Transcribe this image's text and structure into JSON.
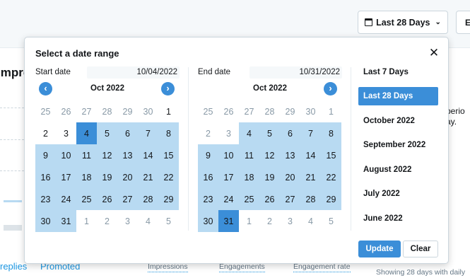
{
  "header": {
    "range_button_label": "Last 28 Days",
    "range_button_icon": "calendar-icon",
    "range_button_chevron": "chevron-down-icon",
    "export_button_label": "E"
  },
  "background": {
    "section_title": "Impres",
    "side_note": [
      "perio",
      "ay."
    ],
    "links": [
      "replies",
      "Promoted"
    ],
    "metric_tabs": [
      "Impressions",
      "Engagements",
      "Engagement rate"
    ],
    "showing_text": "Showing 28 days with daily"
  },
  "date_picker": {
    "title": "Select a date range",
    "close_icon": "close-icon",
    "start": {
      "label": "Start date",
      "value": "10/04/2022",
      "month": "Oct 2022",
      "prev_icon": "chevron-left-icon",
      "next_icon": "chevron-right-icon",
      "weeks": [
        [
          {
            "d": "25",
            "s": "other"
          },
          {
            "d": "26",
            "s": "other"
          },
          {
            "d": "27",
            "s": "other"
          },
          {
            "d": "28",
            "s": "other"
          },
          {
            "d": "29",
            "s": "other"
          },
          {
            "d": "30",
            "s": "other"
          },
          {
            "d": "1",
            "s": "plain"
          }
        ],
        [
          {
            "d": "2",
            "s": "plain"
          },
          {
            "d": "3",
            "s": "plain"
          },
          {
            "d": "4",
            "s": "sel"
          },
          {
            "d": "5",
            "s": "range"
          },
          {
            "d": "6",
            "s": "range"
          },
          {
            "d": "7",
            "s": "range"
          },
          {
            "d": "8",
            "s": "range"
          }
        ],
        [
          {
            "d": "9",
            "s": "range"
          },
          {
            "d": "10",
            "s": "range"
          },
          {
            "d": "11",
            "s": "range"
          },
          {
            "d": "12",
            "s": "range"
          },
          {
            "d": "13",
            "s": "range"
          },
          {
            "d": "14",
            "s": "range"
          },
          {
            "d": "15",
            "s": "range"
          }
        ],
        [
          {
            "d": "16",
            "s": "range"
          },
          {
            "d": "17",
            "s": "range"
          },
          {
            "d": "18",
            "s": "range"
          },
          {
            "d": "19",
            "s": "range"
          },
          {
            "d": "20",
            "s": "range"
          },
          {
            "d": "21",
            "s": "range"
          },
          {
            "d": "22",
            "s": "range"
          }
        ],
        [
          {
            "d": "23",
            "s": "range"
          },
          {
            "d": "24",
            "s": "range"
          },
          {
            "d": "25",
            "s": "range"
          },
          {
            "d": "26",
            "s": "range"
          },
          {
            "d": "27",
            "s": "range"
          },
          {
            "d": "28",
            "s": "range"
          },
          {
            "d": "29",
            "s": "range"
          }
        ],
        [
          {
            "d": "30",
            "s": "range"
          },
          {
            "d": "31",
            "s": "range"
          },
          {
            "d": "1",
            "s": "other"
          },
          {
            "d": "2",
            "s": "other"
          },
          {
            "d": "3",
            "s": "other"
          },
          {
            "d": "4",
            "s": "other"
          },
          {
            "d": "5",
            "s": "other"
          }
        ]
      ]
    },
    "end": {
      "label": "End date",
      "value": "10/31/2022",
      "month": "Oct 2022",
      "next_icon": "chevron-right-icon",
      "weeks": [
        [
          {
            "d": "25",
            "s": "other"
          },
          {
            "d": "26",
            "s": "other"
          },
          {
            "d": "27",
            "s": "other"
          },
          {
            "d": "28",
            "s": "other"
          },
          {
            "d": "29",
            "s": "other"
          },
          {
            "d": "30",
            "s": "other"
          },
          {
            "d": "1",
            "s": "other"
          }
        ],
        [
          {
            "d": "2",
            "s": "other"
          },
          {
            "d": "3",
            "s": "other"
          },
          {
            "d": "4",
            "s": "range"
          },
          {
            "d": "5",
            "s": "range"
          },
          {
            "d": "6",
            "s": "range"
          },
          {
            "d": "7",
            "s": "range"
          },
          {
            "d": "8",
            "s": "range"
          }
        ],
        [
          {
            "d": "9",
            "s": "range"
          },
          {
            "d": "10",
            "s": "range"
          },
          {
            "d": "11",
            "s": "range"
          },
          {
            "d": "12",
            "s": "range"
          },
          {
            "d": "13",
            "s": "range"
          },
          {
            "d": "14",
            "s": "range"
          },
          {
            "d": "15",
            "s": "range"
          }
        ],
        [
          {
            "d": "16",
            "s": "range"
          },
          {
            "d": "17",
            "s": "range"
          },
          {
            "d": "18",
            "s": "range"
          },
          {
            "d": "19",
            "s": "range"
          },
          {
            "d": "20",
            "s": "range"
          },
          {
            "d": "21",
            "s": "range"
          },
          {
            "d": "22",
            "s": "range"
          }
        ],
        [
          {
            "d": "23",
            "s": "range"
          },
          {
            "d": "24",
            "s": "range"
          },
          {
            "d": "25",
            "s": "range"
          },
          {
            "d": "26",
            "s": "range"
          },
          {
            "d": "27",
            "s": "range"
          },
          {
            "d": "28",
            "s": "range"
          },
          {
            "d": "29",
            "s": "range"
          }
        ],
        [
          {
            "d": "30",
            "s": "range"
          },
          {
            "d": "31",
            "s": "sel"
          },
          {
            "d": "1",
            "s": "other"
          },
          {
            "d": "2",
            "s": "other"
          },
          {
            "d": "3",
            "s": "other"
          },
          {
            "d": "4",
            "s": "other"
          },
          {
            "d": "5",
            "s": "other"
          }
        ]
      ]
    },
    "presets": [
      {
        "label": "Last 7 Days",
        "active": false
      },
      {
        "label": "Last 28 Days",
        "active": true
      },
      {
        "label": "October 2022",
        "active": false
      },
      {
        "label": "September 2022",
        "active": false
      },
      {
        "label": "August 2022",
        "active": false
      },
      {
        "label": "July 2022",
        "active": false
      },
      {
        "label": "June 2022",
        "active": false
      }
    ],
    "update_label": "Update",
    "clear_label": "Clear"
  },
  "colors": {
    "accent": "#3b8ed8",
    "range_fill": "#b8daf2",
    "link": "#1b95e0"
  }
}
